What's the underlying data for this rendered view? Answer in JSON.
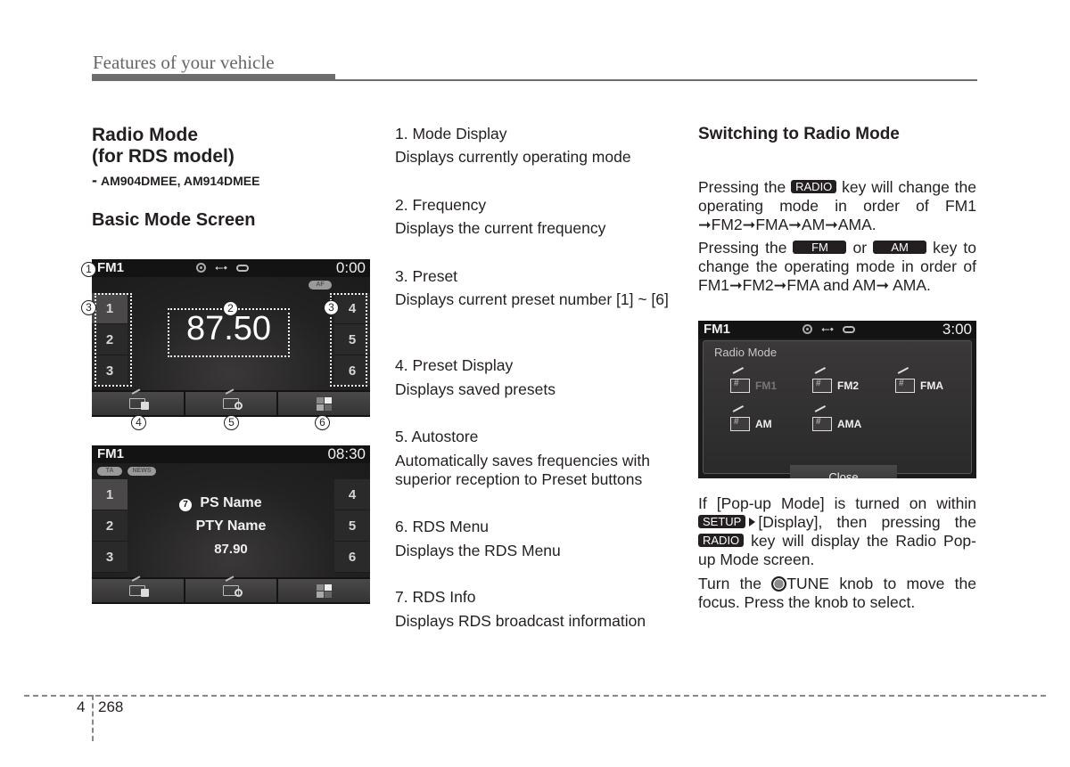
{
  "header": {
    "title": "Features of your vehicle"
  },
  "left": {
    "title_line1": "Radio Mode",
    "title_line2": "(for RDS model)",
    "model_dash": "-",
    "models": "AM904DMEE, AM914DMEE",
    "subtitle": "Basic Mode Screen",
    "screen1": {
      "mode": "FM1",
      "time": "0:00",
      "af_badge": "AF",
      "frequency": "87.50",
      "presets_left": [
        "1",
        "2",
        "3"
      ],
      "presets_right": [
        "4",
        "5",
        "6"
      ],
      "callouts": {
        "mode": "1",
        "frequency": "2",
        "preset_left": "3",
        "preset_right": "3",
        "btn1": "4",
        "btn2": "5",
        "btn3": "6"
      }
    },
    "screen2": {
      "mode": "FM1",
      "time": "08:30",
      "badges": [
        "TA",
        "NEWS"
      ],
      "ps_name": "PS Name",
      "pty_name": "PTY Name",
      "frequency": "87.90",
      "presets_left": [
        "1",
        "2",
        "3"
      ],
      "presets_right": [
        "4",
        "5",
        "6"
      ],
      "callout": "7"
    }
  },
  "middle": {
    "items": [
      {
        "title": "1. Mode Display",
        "desc": "Displays currently operating mode"
      },
      {
        "title": "2. Frequency",
        "desc": "Displays the current frequency"
      },
      {
        "title": "3. Preset",
        "desc": "Displays current preset number [1] ~ [6]"
      },
      {
        "title": "4. Preset Display",
        "desc": "Displays saved presets"
      },
      {
        "title": "5. Autostore",
        "desc": "Automatically saves frequencies with superior reception to Preset buttons"
      },
      {
        "title": "6. RDS Menu",
        "desc": "Displays the RDS Menu"
      },
      {
        "title": "7. RDS Info",
        "desc": "Displays RDS broadcast information"
      }
    ]
  },
  "right": {
    "title": "Switching to Radio Mode",
    "p1_a": "Pressing the",
    "p1_key": "RADIO",
    "p1_b": "key will change the operating mode in order of FM1 ➞FM2➞FMA➞AM➞AMA.",
    "p2_a": "Pressing the",
    "p2_key1": "FM",
    "p2_or": "or",
    "p2_key2": "AM",
    "p2_b": "key to change the operating mode in order of FM1➞FM2➞FMA and AM➞ AMA.",
    "popup_screen": {
      "mode": "FM1",
      "time": "3:00",
      "popup_title": "Radio Mode",
      "options": [
        "FM1",
        "FM2",
        "FMA",
        "AM",
        "AMA"
      ],
      "close_label": "Close"
    },
    "p3_a": "If [Pop-up Mode] is turned on within",
    "p3_key1": "SETUP",
    "p3_b": "[Display], then pressing the",
    "p3_key2": "RADIO",
    "p3_c": "key will display the Radio Pop-up Mode screen.",
    "p4_a": "Turn the",
    "p4_b": "TUNE knob to move the focus. Press the knob to select."
  },
  "footer": {
    "chapter": "4",
    "page": "268"
  }
}
